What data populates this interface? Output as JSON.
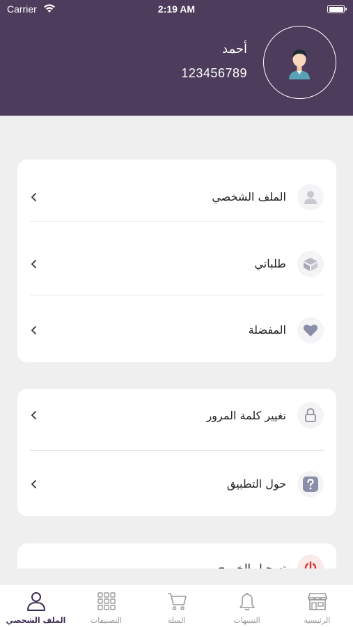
{
  "status_bar": {
    "carrier": "Carrier",
    "time": "2:19 AM"
  },
  "profile": {
    "name": "أحمد",
    "phone": "123456789"
  },
  "menu_group_1": [
    {
      "label": "الملف الشخصي",
      "icon": "user-icon"
    },
    {
      "label": "طلباتي",
      "icon": "box-icon"
    },
    {
      "label": "المفضلة",
      "icon": "heart-icon"
    }
  ],
  "menu_group_2": [
    {
      "label": "تغيير كلمة المرور",
      "icon": "lock-icon"
    },
    {
      "label": "حول التطبيق",
      "icon": "question-icon"
    }
  ],
  "menu_group_3": [
    {
      "label": "تسجيل الخروج",
      "icon": "power-icon"
    }
  ],
  "tabbar": {
    "home": "الرئيسية",
    "notifications": "التنبيهات",
    "cart": "السلة",
    "categories": "التصنيفات",
    "profile": "الملف الشخصي"
  },
  "colors": {
    "header": "#4d3c5c",
    "accent": "#3e2f55",
    "logout": "#d0302c"
  }
}
